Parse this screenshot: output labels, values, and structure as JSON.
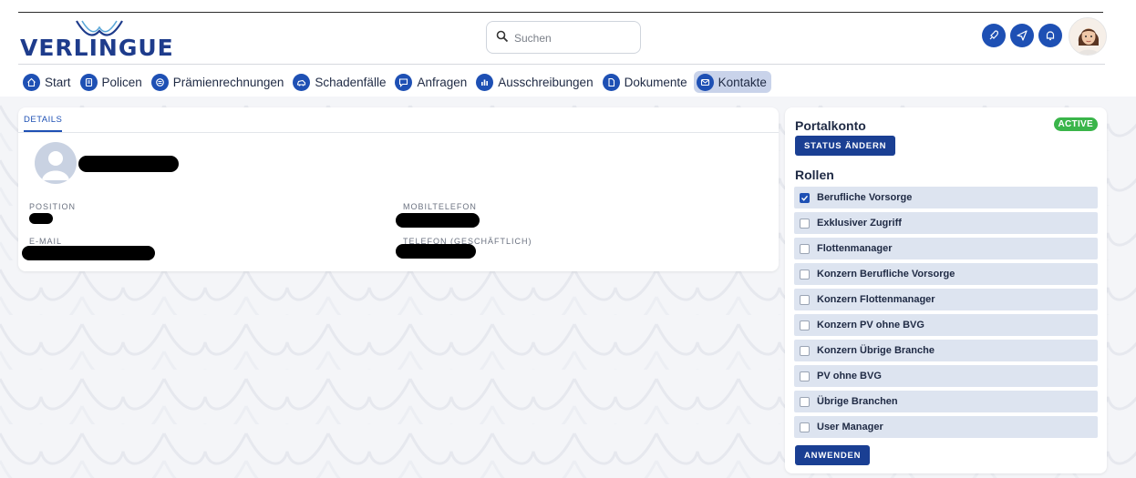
{
  "brand": {
    "logo_text": "VERLINGUE"
  },
  "search": {
    "placeholder": "Suchen"
  },
  "nav": [
    {
      "label": "Start",
      "icon": "home-icon"
    },
    {
      "label": "Policen",
      "icon": "document-icon"
    },
    {
      "label": "Prämienrechnungen",
      "icon": "invoice-icon"
    },
    {
      "label": "Schadenfälle",
      "icon": "car-crash-icon"
    },
    {
      "label": "Anfragen",
      "icon": "chat-icon"
    },
    {
      "label": "Ausschreibungen",
      "icon": "bar-chart-icon"
    },
    {
      "label": "Dokumente",
      "icon": "file-icon"
    },
    {
      "label": "Kontakte",
      "icon": "mail-icon",
      "active": true
    }
  ],
  "details": {
    "tab_label": "DETAILS",
    "labels": {
      "position": "POSITION",
      "mobile": "MOBILTELEFON",
      "email": "E-MAIL",
      "phone_business": "TELEFON (GESCHÄFTLICH)"
    }
  },
  "portal": {
    "title": "Portalkonto",
    "status_badge": "ACTIVE",
    "change_status_label": "STATUS ÄNDERN",
    "roles_title": "Rollen",
    "apply_label": "ANWENDEN",
    "roles": [
      {
        "label": "Berufliche Vorsorge",
        "checked": true
      },
      {
        "label": "Exklusiver Zugriff",
        "checked": false
      },
      {
        "label": "Flottenmanager",
        "checked": false
      },
      {
        "label": "Konzern Berufliche Vorsorge",
        "checked": false
      },
      {
        "label": "Konzern Flottenmanager",
        "checked": false
      },
      {
        "label": "Konzern PV ohne BVG",
        "checked": false
      },
      {
        "label": "Konzern Übrige Branche",
        "checked": false
      },
      {
        "label": "PV ohne BVG",
        "checked": false
      },
      {
        "label": "Übrige Branchen",
        "checked": false
      },
      {
        "label": "User Manager",
        "checked": false
      }
    ]
  },
  "colors": {
    "primary": "#1e50b4",
    "dark_blue": "#1a3f93",
    "active_green": "#3ab54a",
    "role_bg": "#dde4f0"
  }
}
